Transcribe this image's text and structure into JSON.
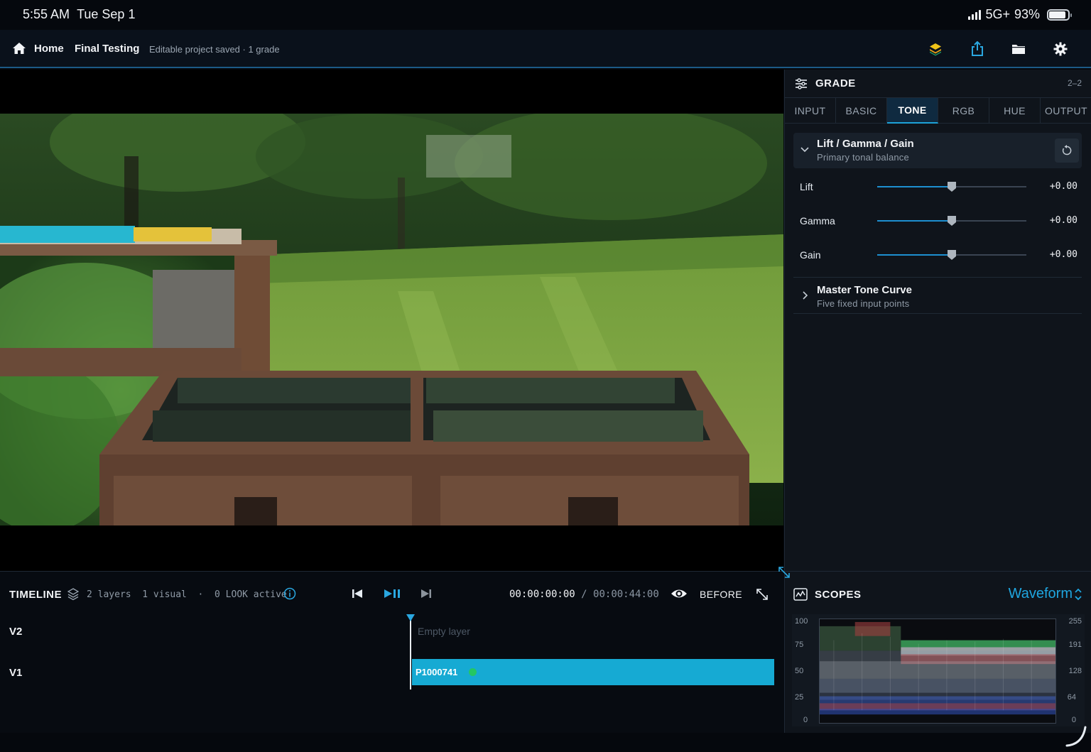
{
  "status_bar": {
    "time": "5:55 AM",
    "date": "Tue Sep 1",
    "network": "5G+",
    "battery": "93%",
    "battery_level": 0.93
  },
  "nav": {
    "home": "Home",
    "project": "Final Testing",
    "status": "Editable project saved · 1 grade",
    "icons": [
      "home-icon",
      "layers-icon",
      "share-icon",
      "folder-icon",
      "gear-icon"
    ]
  },
  "grade": {
    "title": "GRADE",
    "range": "2–2",
    "tabs": [
      "INPUT",
      "BASIC",
      "TONE",
      "RGB",
      "HUE",
      "OUTPUT"
    ],
    "active_tab": "TONE",
    "lgg": {
      "title": "Lift / Gamma / Gain",
      "subtitle": "Primary tonal balance",
      "sliders": [
        {
          "label": "Lift",
          "value": "+0.00",
          "level": 0.5
        },
        {
          "label": "Gamma",
          "value": "+0.00",
          "level": 0.5
        },
        {
          "label": "Gain",
          "value": "+0.00",
          "level": 0.5
        }
      ]
    },
    "curve": {
      "title": "Master Tone Curve",
      "subtitle": "Five fixed input points"
    }
  },
  "timeline": {
    "title": "TIMELINE",
    "info": "2 layers  1 visual  ·  0 LOOK active",
    "timecode": "00:00:00:00",
    "separator": "/",
    "duration": "00:00:44:00",
    "before_label": "BEFORE",
    "tracks": [
      {
        "label": "V2",
        "content": "Empty layer"
      },
      {
        "label": "V1",
        "clip": "P1000741"
      }
    ],
    "accent": "#16aad3"
  },
  "scopes": {
    "title": "SCOPES",
    "mode": "Waveform",
    "left_ticks": [
      "100",
      "75",
      "50",
      "25",
      "0"
    ],
    "right_ticks": [
      "255",
      "191",
      "128",
      "64",
      "0"
    ]
  }
}
